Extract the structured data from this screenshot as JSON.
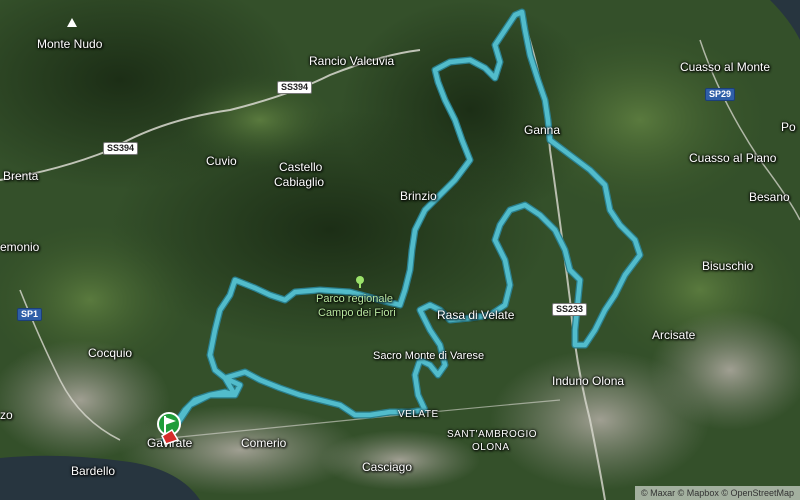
{
  "places": {
    "monte_nudo": "Monte Nudo",
    "rancio_valcuvia": "Rancio Valcuvia",
    "cuasso_al_monte": "Cuasso al Monte",
    "cuvio": "Cuvio",
    "castello_cabiaglio_1": "Castello",
    "castello_cabiaglio_2": "Cabiaglio",
    "brenta": "Brenta",
    "brinzio": "Brinzio",
    "ganna": "Ganna",
    "cuasso_al_piano": "Cuasso al Piano",
    "besano": "Besano",
    "porto": "Po",
    "gemonio": "emonio",
    "bisuschio": "Bisuschio",
    "parco_1": "Parco regionale",
    "parco_2": "Campo dei Fiori",
    "rasa": "Rasa di Velate",
    "arcisate": "Arcisate",
    "cocquio": "Cocquio",
    "sacro_monte": "Sacro Monte di Varese",
    "induno_olona": "Induno Olona",
    "velate": "VELATE",
    "sant_ambrogio_1": "SANT'AMBROGIO",
    "sant_ambrogio_2": "OLONA",
    "comerio": "Comerio",
    "gavirate": "Gavirate",
    "casciago": "Casciago",
    "bardello": "Bardello",
    "left_edge": "zo"
  },
  "roads": {
    "ss394_a": "SS394",
    "ss394_b": "SS394",
    "sp29": "SP29",
    "sp1": "SP1",
    "ss233": "SS233"
  },
  "attribution": "© Maxar © Mapbox © OpenStreetMap",
  "colors": {
    "route": "#4fb8c8",
    "route_outline": "#2a7f8d",
    "terrain_dark": "#243a1c",
    "terrain_mid": "#3d5a2c",
    "urban": "#8b8f82",
    "lake": "#27353f"
  }
}
